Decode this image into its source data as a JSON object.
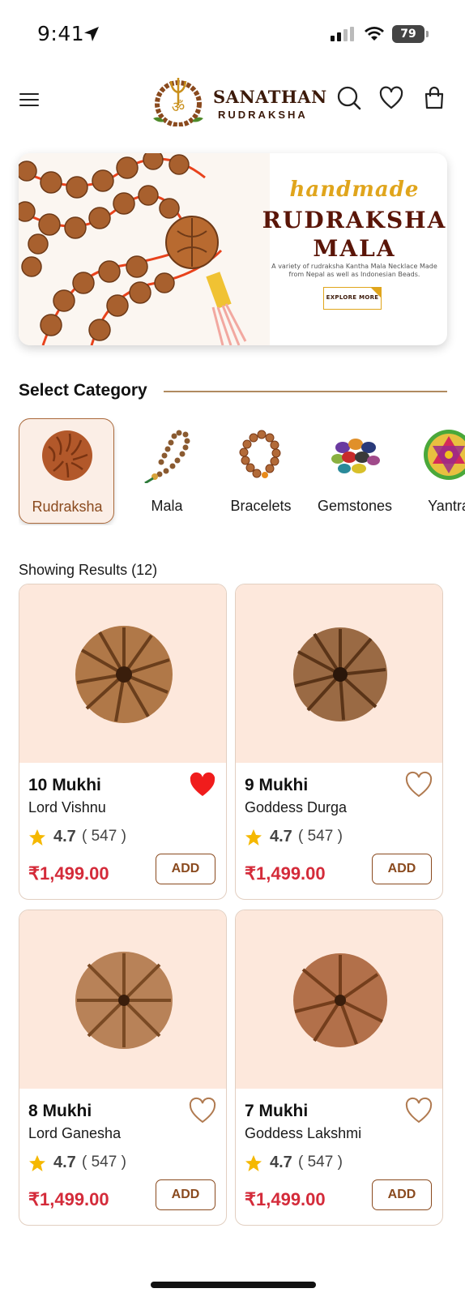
{
  "status_bar": {
    "time": "9:41",
    "battery": "79"
  },
  "header": {
    "brand_title": "SANATHAN",
    "brand_subtitle": "RUDRAKSHA"
  },
  "banner": {
    "script_text": "handmade",
    "title_line1": "RUDRAKSHA",
    "title_line2": "MALA",
    "description": "A variety of rudraksha Kantha Mala Necklace Made from Nepal as well as Indonesian Beads.",
    "cta_label": "EXPLORE MORE"
  },
  "categories_section": {
    "title": "Select Category",
    "items": [
      {
        "label": "Rudraksha",
        "icon": "rudraksha-bead-icon",
        "active": true
      },
      {
        "label": "Mala",
        "icon": "mala-icon",
        "active": false
      },
      {
        "label": "Bracelets",
        "icon": "bracelet-icon",
        "active": false
      },
      {
        "label": "Gemstones",
        "icon": "gemstones-icon",
        "active": false
      },
      {
        "label": "Yantra",
        "icon": "yantra-icon",
        "active": false
      }
    ]
  },
  "results_label": "Showing Results (12)",
  "products": [
    {
      "name": "10 Mukhi",
      "deity": "Lord Vishnu",
      "rating": "4.7",
      "reviews": "( 547 )",
      "price": "₹1,499.00",
      "favorited": true,
      "add_label": "ADD"
    },
    {
      "name": "9 Mukhi",
      "deity": "Goddess Durga",
      "rating": "4.7",
      "reviews": "( 547 )",
      "price": "₹1,499.00",
      "favorited": false,
      "add_label": "ADD"
    },
    {
      "name": "8 Mukhi",
      "deity": "Lord Ganesha",
      "rating": "4.7",
      "reviews": "( 547 )",
      "price": "₹1,499.00",
      "favorited": false,
      "add_label": "ADD"
    },
    {
      "name": "7 Mukhi",
      "deity": "Goddess Lakshmi",
      "rating": "4.7",
      "reviews": "( 547 )",
      "price": "₹1,499.00",
      "favorited": false,
      "add_label": "ADD"
    }
  ],
  "colors": {
    "accent_brown": "#8a4a1e",
    "price_red": "#d42b3a",
    "card_bg": "#fde8dc",
    "banner_gold": "#e0a51c",
    "favorite_red": "#f01c1c"
  }
}
